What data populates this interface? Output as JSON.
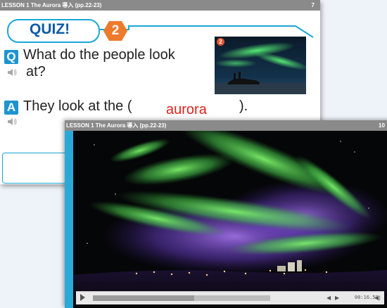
{
  "slide_back": {
    "header": "LESSON 1  The Aurora  導入  (pp.22-23)",
    "page_number": "7",
    "quiz_label": "QUIZ!",
    "quiz_number": "2",
    "question_badge": "Q",
    "question_line1": "What do the people look",
    "question_line2": "at?",
    "answer_badge": "A",
    "answer_prefix": "They look at the (",
    "answer_word": "aurora",
    "answer_suffix": ").",
    "thumbnail_number": "2"
  },
  "video_window": {
    "header": "LESSON 1  The Aurora  導入  (pp.22-23)",
    "page_number": "10",
    "progress": 0.57,
    "time": "00:16.59",
    "icons": [
      "play-icon",
      "prev-icon",
      "next-icon",
      "volume-icon"
    ]
  },
  "colors": {
    "accent": "#1aa7d6",
    "answer": "#e0221c",
    "orange": "#ee7a2b"
  }
}
